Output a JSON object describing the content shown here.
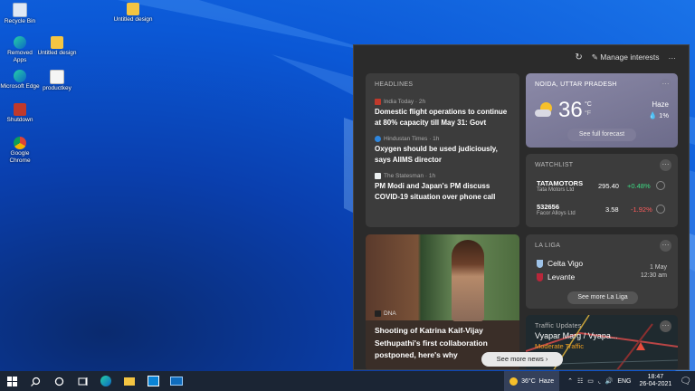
{
  "desktop": {
    "icons": [
      {
        "label": "Recycle Bin"
      },
      {
        "label": "Untitled design"
      },
      {
        "label": "Removed Apps"
      },
      {
        "label": "Untitled design"
      },
      {
        "label": "Microsoft Edge"
      },
      {
        "label": "productkey"
      },
      {
        "label": "Shutdown"
      },
      {
        "label": "Google Chrome"
      }
    ]
  },
  "panel": {
    "refresh_icon": "refresh-icon",
    "manage_label": "Manage interests",
    "more_label": "···"
  },
  "headlines": {
    "title": "HEADLINES",
    "items": [
      {
        "source": "India Today · 2h",
        "headline": "Domestic flight operations to continue at 80% capacity till May 31: Govt",
        "color": "#c0392b"
      },
      {
        "source": "Hindustan Times · 1h",
        "headline": "Oxygen should be used judiciously, says AIIMS director",
        "color": "#2e86de"
      },
      {
        "source": "The Statesman · 1h",
        "headline": "PM Modi and Japan's PM discuss COVID-19 situation over phone call",
        "color": "#ecf0f1"
      }
    ]
  },
  "weather": {
    "location": "NOIDA, UTTAR PRADESH",
    "temp": "36",
    "unit_c": "°C",
    "unit_f": "°F",
    "condition": "Haze",
    "precip": "1%",
    "forecast_label": "See full forecast"
  },
  "feature": {
    "source": "DNA",
    "headline": "Shooting of Katrina Kaif-Vijay Sethupathi's first collaboration postponed, here's why"
  },
  "watchlist": {
    "title": "WATCHLIST",
    "rows": [
      {
        "ticker": "TATAMOTORS",
        "name": "Tata Motors Ltd",
        "price": "295.40",
        "change": "+0.48%",
        "color": "#3ddc84"
      },
      {
        "ticker": "532656",
        "name": "Facor Alloys Ltd",
        "price": "3.58",
        "change": "-1.92%",
        "color": "#ff5c5c"
      }
    ]
  },
  "laliga": {
    "title": "LA LIGA",
    "team1": "Celta Vigo",
    "team2": "Levante",
    "date": "1 May",
    "time": "12:30 am",
    "more_label": "See more La Liga"
  },
  "traffic": {
    "title": "Traffic Updates",
    "road": "Vyapar Marg / Vyapa...",
    "status": "Moderate Traffic"
  },
  "see_more_news": "See more news",
  "taskbar": {
    "weather_temp": "36°C",
    "weather_cond": "Haze",
    "lang": "ENG",
    "time": "18:47",
    "date": "26-04-2021"
  }
}
